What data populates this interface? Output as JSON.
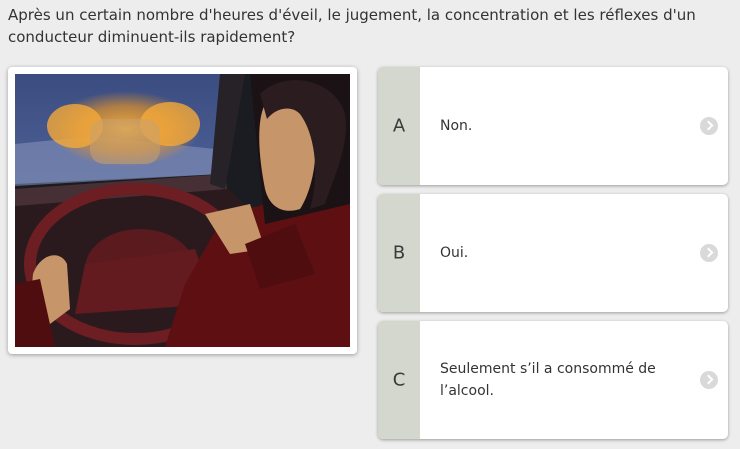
{
  "question": {
    "text": "Après un certain nombre d'heures d'éveil, le jugement, la concentration et les réflexes d'un conducteur diminuent-ils rapidement?"
  },
  "illustration": {
    "icon": "driver-night-illustration"
  },
  "answers": [
    {
      "letter": "A",
      "text": "Non.",
      "icon": "chevron-right-icon"
    },
    {
      "letter": "B",
      "text": "Oui.",
      "icon": "chevron-right-icon"
    },
    {
      "letter": "C",
      "text": "Seulement s’il a consommé de l’alcool.",
      "icon": "chevron-right-icon"
    }
  ],
  "colors": {
    "background": "#ededed",
    "letter_box": "#d3d7cd",
    "chevron": "#d9d9d9"
  }
}
